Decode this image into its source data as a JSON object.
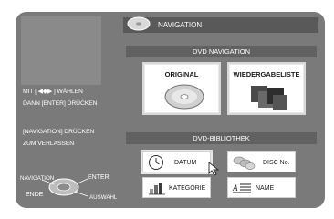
{
  "header": {
    "title": "NAVIGATION"
  },
  "sections": {
    "dvd_navigation": "DVD NAVIGATION",
    "dvd_bibliothek": "DVD-BIBLIOTHEK"
  },
  "navigation_buttons": [
    {
      "label": "ORIGINAL",
      "icon": "disc-icon"
    },
    {
      "label": "WIEDERGABELISTE",
      "icon": "playlist-icon"
    }
  ],
  "library_buttons": [
    {
      "label": "DATUM",
      "icon": "clock-icon",
      "selected": true
    },
    {
      "label": "DISC No.",
      "icon": "discs-icon",
      "selected": false
    },
    {
      "label": "KATEGORIE",
      "icon": "category-icon",
      "selected": false
    },
    {
      "label": "NAME",
      "icon": "name-list-icon",
      "selected": false
    }
  ],
  "help": {
    "line1": "MIT [ ◀◆▶ ] WÄHLEN",
    "line2": "DANN [ENTER] DRÜCKEN",
    "line3": "[NAVIGATION] DRÜCKEN",
    "line4": "ZUM VERLASSEN"
  },
  "remote": {
    "navigation": "NAVIGATION",
    "enter": "ENTER",
    "ende": "ENDE",
    "auswahl": "AUSWAHL"
  }
}
